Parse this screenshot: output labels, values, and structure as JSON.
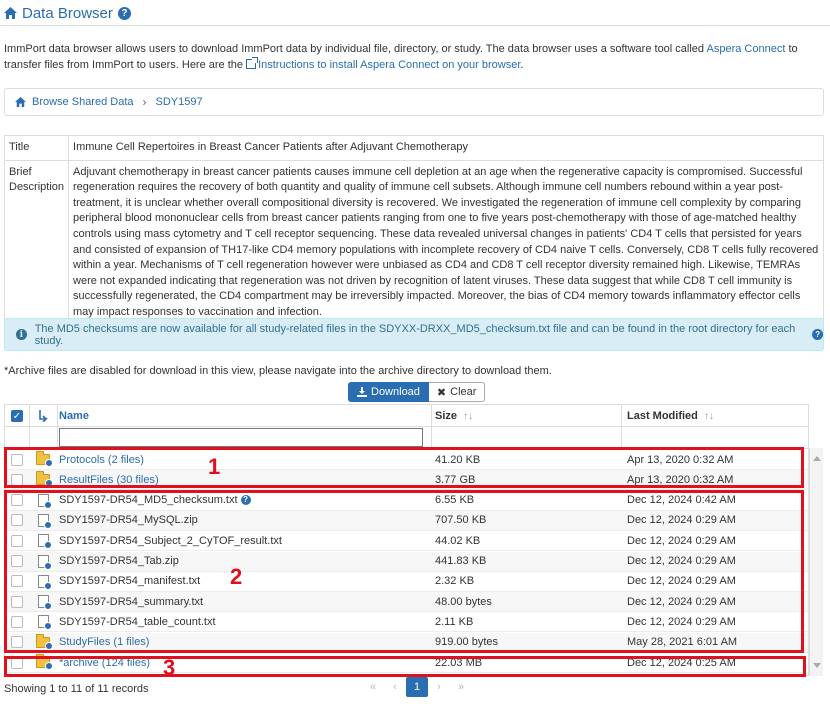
{
  "header": {
    "title": "Data Browser"
  },
  "intro": {
    "text1": "ImmPort data browser allows users to download ImmPort data by individual file, directory, or study. The data browser uses a software tool called ",
    "link1": "Aspera Connect",
    "text2": " to transfer files from ImmPort to users. Here are the ",
    "link2": "Instructions to install Aspera Connect on your browser",
    "text3": "."
  },
  "breadcrumb": {
    "root": "Browse Shared Data",
    "current": "SDY1597"
  },
  "study": {
    "title_label": "Title",
    "title_value": "Immune Cell Repertoires in Breast Cancer Patients after Adjuvant Chemotherapy",
    "desc_label": "Brief Description",
    "desc_value": "Adjuvant chemotherapy in breast cancer patients causes immune cell depletion at an age when the regenerative capacity is compromised. Successful regeneration requires the recovery of both quantity and quality of immune cell subsets. Although immune cell numbers rebound within a year post-treatment, it is unclear whether overall compositional diversity is recovered. We investigated the regeneration of immune cell complexity by comparing peripheral blood mononuclear cells from breast cancer patients ranging from one to five years post-chemotherapy with those of age-matched healthy controls using mass cytometry and T cell receptor sequencing. These data revealed universal changes in patients' CD4 T cells that persisted for years and consisted of expansion of TH17-like CD4 memory populations with incomplete recovery of CD4 naive T cells. Conversely, CD8 T cells fully recovered within a year. Mechanisms of T cell regeneration however were unbiased as CD4 and CD8 T cell receptor diversity remained high. Likewise, TEMRAs were not expanded indicating that regeneration was not driven by recognition of latent viruses. These data suggest that while CD8 T cell immunity is successfully regenerated, the CD4 compartment may be irreversibly impacted. Moreover, the bias of CD4 memory towards inflammatory effector cells may impact responses to vaccination and infection."
  },
  "notice": "The MD5 checksums are now available for all study-related files in the SDYXX-DRXX_MD5_checksum.txt file and can be found in the root directory for each study.",
  "archive_note": "*Archive files are disabled for download in this view, please navigate into the archive directory to download them.",
  "buttons": {
    "download": "Download",
    "clear": "Clear"
  },
  "columns": {
    "name": "Name",
    "size": "Size",
    "modified": "Last Modified"
  },
  "rows": [
    {
      "name": "Protocols (2 files)",
      "size": "41.20 KB",
      "modified": "Apr 13, 2020 0:32 AM",
      "type": "folder"
    },
    {
      "name": "ResultFiles (30 files)",
      "size": "3.77 GB",
      "modified": "Apr 13, 2020 0:32 AM",
      "type": "folder"
    },
    {
      "name": "SDY1597-DR54_MD5_checksum.txt",
      "size": "6.55 KB",
      "modified": "Dec 12, 2024 0:42 AM",
      "type": "file"
    },
    {
      "name": "SDY1597-DR54_MySQL.zip",
      "size": "707.50 KB",
      "modified": "Dec 12, 2024 0:29 AM",
      "type": "file"
    },
    {
      "name": "SDY1597-DR54_Subject_2_CyTOF_result.txt",
      "size": "44.02 KB",
      "modified": "Dec 12, 2024 0:29 AM",
      "type": "file"
    },
    {
      "name": "SDY1597-DR54_Tab.zip",
      "size": "441.83 KB",
      "modified": "Dec 12, 2024 0:29 AM",
      "type": "file"
    },
    {
      "name": "SDY1597-DR54_manifest.txt",
      "size": "2.32 KB",
      "modified": "Dec 12, 2024 0:29 AM",
      "type": "file"
    },
    {
      "name": "SDY1597-DR54_summary.txt",
      "size": "48.00 bytes",
      "modified": "Dec 12, 2024 0:29 AM",
      "type": "file"
    },
    {
      "name": "SDY1597-DR54_table_count.txt",
      "size": "2.11 KB",
      "modified": "Dec 12, 2024 0:29 AM",
      "type": "file"
    },
    {
      "name": "StudyFiles (1 files)",
      "size": "919.00 bytes",
      "modified": "May 28, 2021 6:01 AM",
      "type": "folder"
    },
    {
      "name": "*archive (124 files)",
      "size": "22.03 MB",
      "modified": "Dec 12, 2024 0:25 AM",
      "type": "folder"
    }
  ],
  "annotations": {
    "label1": "1",
    "label2": "2",
    "label3": "3"
  },
  "footer": {
    "records": "Showing 1 to 11 of 11 records",
    "page": "1"
  },
  "colors": {
    "accent": "#2a6db0",
    "highlight": "#e0101c",
    "info_bg": "#d9edf7"
  }
}
